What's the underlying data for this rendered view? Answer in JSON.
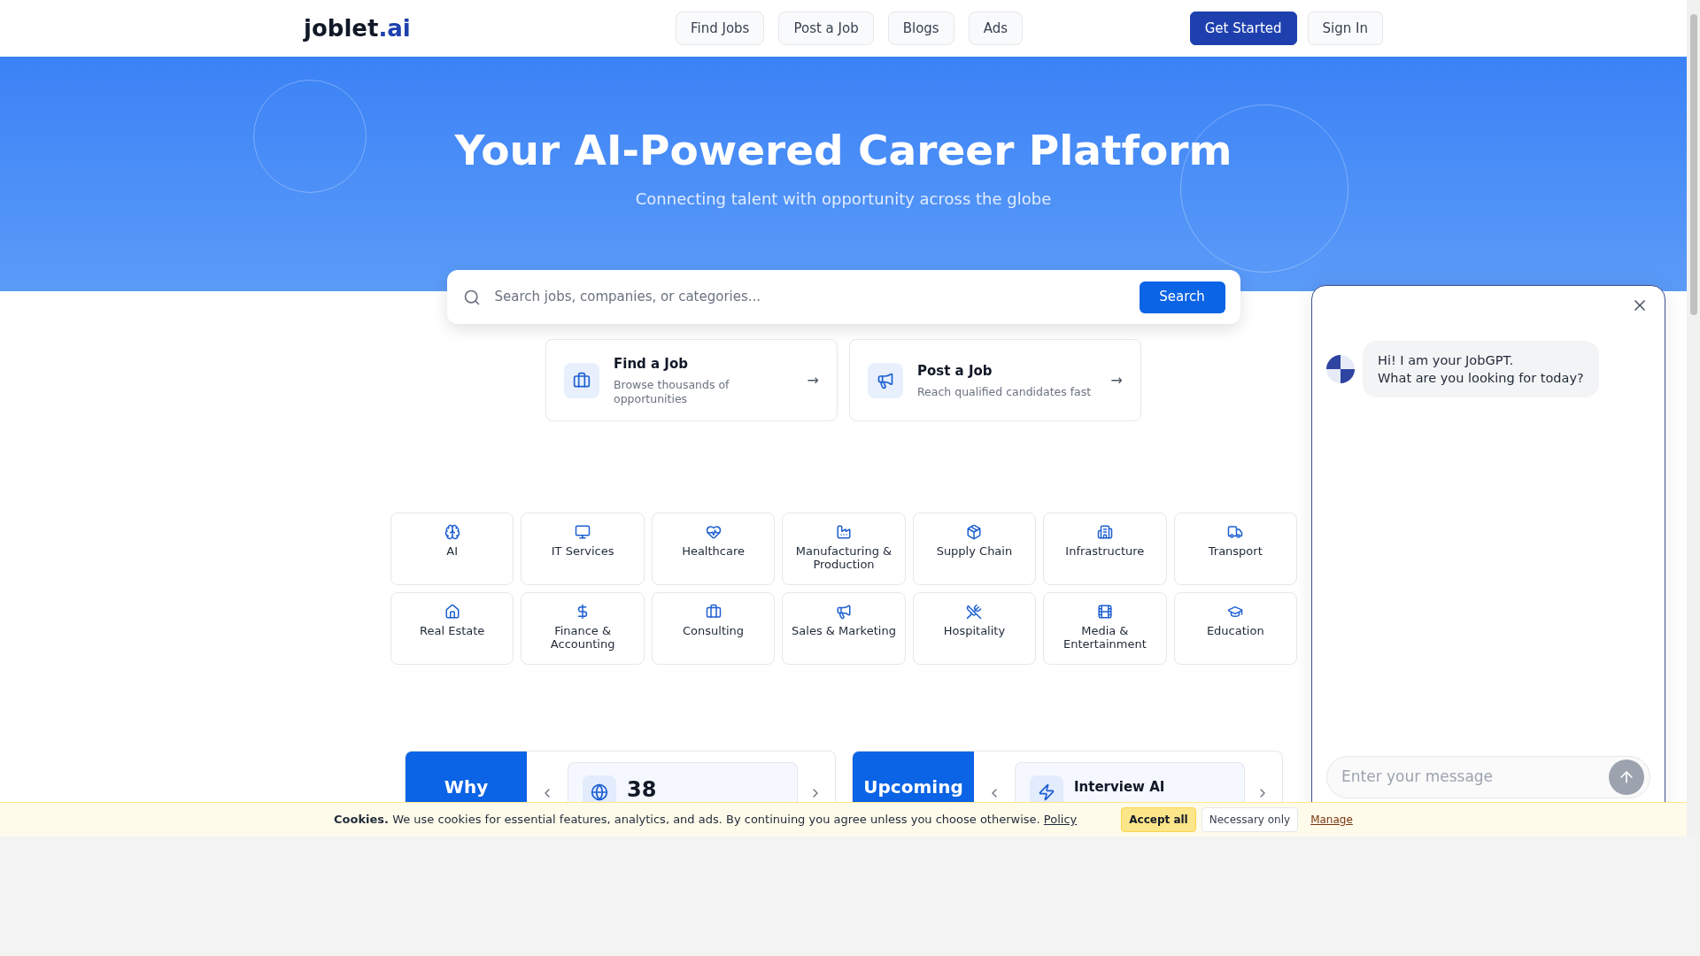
{
  "header": {
    "logo": {
      "main": "joblet",
      "accent": ".ai"
    },
    "nav": [
      "Find Jobs",
      "Post a Job",
      "Blogs",
      "Ads"
    ],
    "actions": [
      {
        "label": "Get Started",
        "kind": "primary"
      },
      {
        "label": "Sign In",
        "kind": "secondary"
      }
    ]
  },
  "hero": {
    "title": "Your AI-Powered Career Platform",
    "subtitle": "Connecting talent with opportunity across the globe"
  },
  "search": {
    "placeholder": "Search jobs, companies, or categories...",
    "button": "Search"
  },
  "quick_actions": [
    {
      "title": "Find a Job",
      "description": "Browse thousands of opportunities",
      "arrow": "→"
    },
    {
      "title": "Post a Job",
      "description": "Reach qualified candidates fast",
      "arrow": "→"
    }
  ],
  "categories": [
    "AI",
    "IT Services",
    "Healthcare",
    "Manufacturing & Production",
    "Supply Chain",
    "Infrastructure",
    "Transport",
    "Real Estate",
    "Finance & Accounting",
    "Consulting",
    "Sales & Marketing",
    "Hospitality",
    "Media & Entertainment",
    "Education"
  ],
  "promo_cards": [
    {
      "tab": "Why",
      "value": "38"
    },
    {
      "tab": "Upcoming",
      "value": "Interview AI"
    }
  ],
  "chat": {
    "messages": [
      "Hi! I am your JobGPT.\nWhat are you looking for today?"
    ],
    "placeholder": "Enter your message"
  },
  "cookie_bar": {
    "text": "**Cookies.** We use cookies for essential features, analytics, and ads. By continuing you agree unless you choose otherwise.",
    "link": "Policy",
    "buttons": [
      {
        "label": "Accept all",
        "kind": "accept"
      },
      {
        "label": "Necessary only",
        "kind": "necessary"
      },
      {
        "label": "Manage",
        "kind": "link"
      }
    ]
  }
}
